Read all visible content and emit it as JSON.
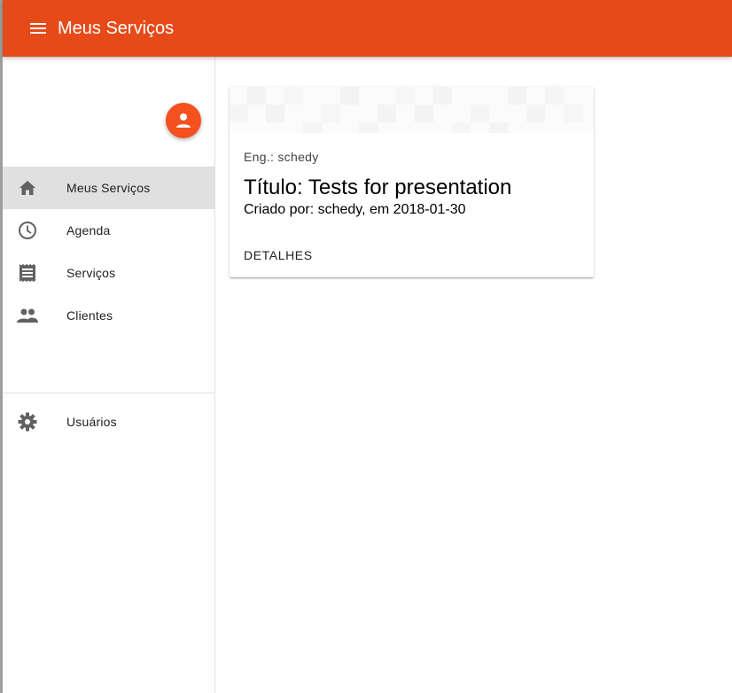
{
  "toolbar": {
    "title": "Meus Serviços",
    "menu_icon": "menu-icon",
    "color": "#e64a19"
  },
  "drawer": {
    "avatar_icon": "account-circle-icon",
    "avatar_color": "#f4511e",
    "items": [
      {
        "label": "Meus Serviços",
        "icon": "home-icon",
        "active": true
      },
      {
        "label": "Agenda",
        "icon": "clock-icon",
        "active": false
      },
      {
        "label": "Serviços",
        "icon": "receipt-icon",
        "active": false
      },
      {
        "label": "Clientes",
        "icon": "people-icon",
        "active": false
      }
    ],
    "secondary_items": [
      {
        "label": "Usuários",
        "icon": "gear-icon",
        "active": false
      }
    ]
  },
  "card": {
    "engineer": "Eng.: schedy",
    "title": "Título: Tests for presentation",
    "subtitle": "Criado por: schedy, em 2018-01-30",
    "action_label": "DETALHES"
  }
}
